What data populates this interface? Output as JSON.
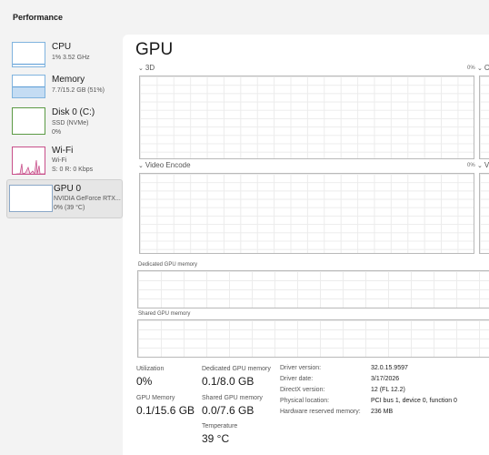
{
  "window": {
    "title": "Performance"
  },
  "sidebar": {
    "items": [
      {
        "name": "CPU",
        "sub1": "1% 3.52 GHz"
      },
      {
        "name": "Memory",
        "sub1": "7.7/15.2 GB (51%)",
        "fill": 0.51
      },
      {
        "name": "Disk 0 (C:)",
        "sub1": "SSD (NVMe)",
        "sub2": "0%"
      },
      {
        "name": "Wi-Fi",
        "sub1": "Wi-Fi",
        "sub2": "S: 0 R: 0 Kbps"
      },
      {
        "name": "GPU 0",
        "sub1": "NVIDIA GeForce RTX...",
        "sub2": "0% (39 °C)"
      }
    ]
  },
  "main": {
    "title": "GPU",
    "engines": [
      {
        "label": "3D",
        "pct": "0%",
        "next_label": "C"
      },
      {
        "label": "Video Encode",
        "pct": "0%",
        "next_label": "V"
      }
    ],
    "memory_graphs": [
      {
        "label": "Dedicated GPU memory"
      },
      {
        "label": "Shared GPU memory"
      }
    ],
    "stats": {
      "utilization_label": "Utilization",
      "utilization_value": "0%",
      "dedicated_label": "Dedicated GPU memory",
      "dedicated_value": "0.1/8.0 GB",
      "gpu_memory_label": "GPU Memory",
      "gpu_memory_value": "0.1/15.6 GB",
      "shared_label": "Shared GPU memory",
      "shared_value": "0.0/7.6 GB",
      "temperature_label": "Temperature",
      "temperature_value": "39 °C"
    },
    "info": [
      {
        "key": "Driver version:",
        "value": "32.0.15.9597"
      },
      {
        "key": "Driver date:",
        "value": "3/17/2026"
      },
      {
        "key": "DirectX version:",
        "value": "12 (FL 12.2)"
      },
      {
        "key": "Physical location:",
        "value": "PCI bus 1, device 0, function 0"
      },
      {
        "key": "Hardware reserved memory:",
        "value": "236 MB"
      }
    ]
  }
}
